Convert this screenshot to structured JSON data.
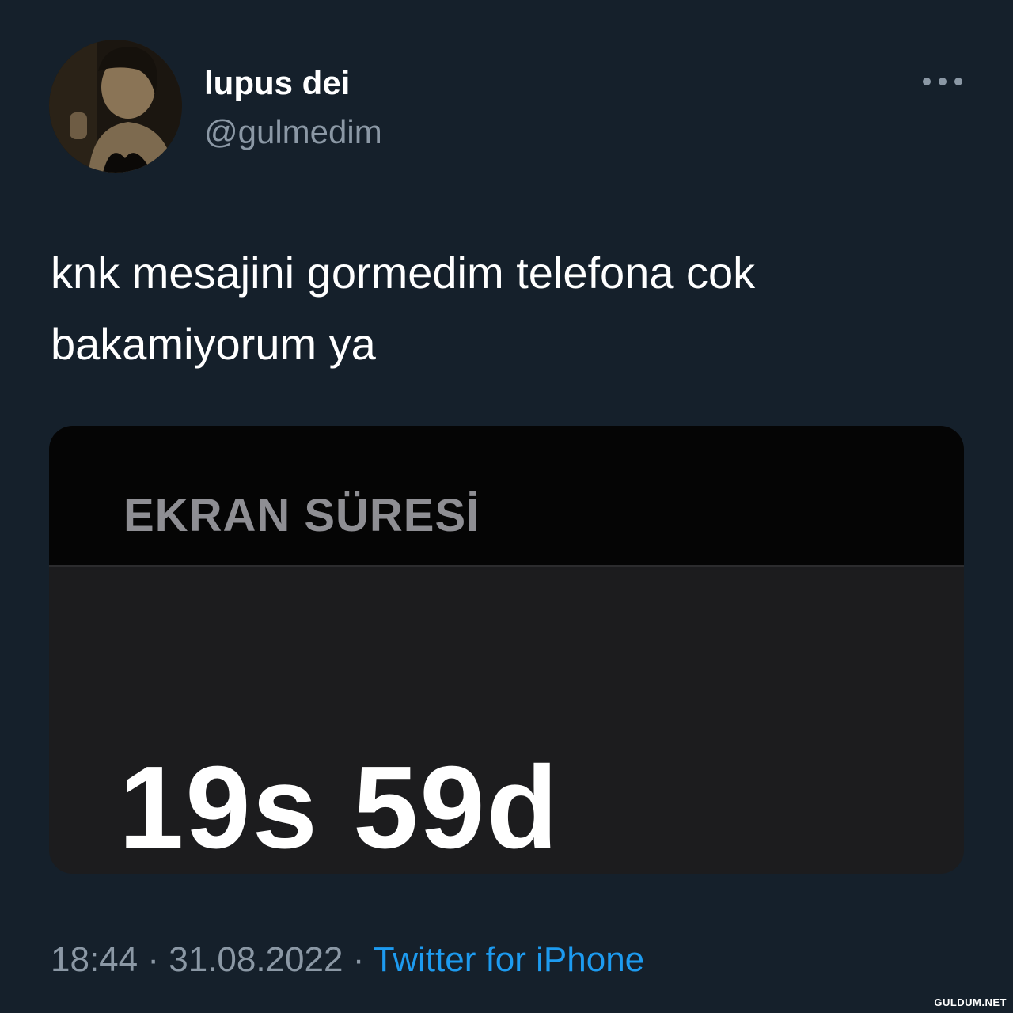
{
  "tweet": {
    "author": {
      "display_name": "lupus dei",
      "handle": "@gulmedim",
      "avatar_icon": "profile-photo"
    },
    "text_lines": [
      "knk mesajini gormedim telefona cok",
      "bakamiyorum ya"
    ],
    "media": {
      "header_label": "EKRAN SÜRESİ",
      "value": "19s 59d"
    },
    "meta": {
      "time": "18:44",
      "separator": "·",
      "date": "31.08.2022",
      "source": "Twitter for iPhone"
    }
  },
  "watermark": "GULDUM.NET",
  "colors": {
    "background": "#15202b",
    "text_primary": "#ffffff",
    "text_secondary": "#8b98a5",
    "link": "#1d9bf0"
  }
}
